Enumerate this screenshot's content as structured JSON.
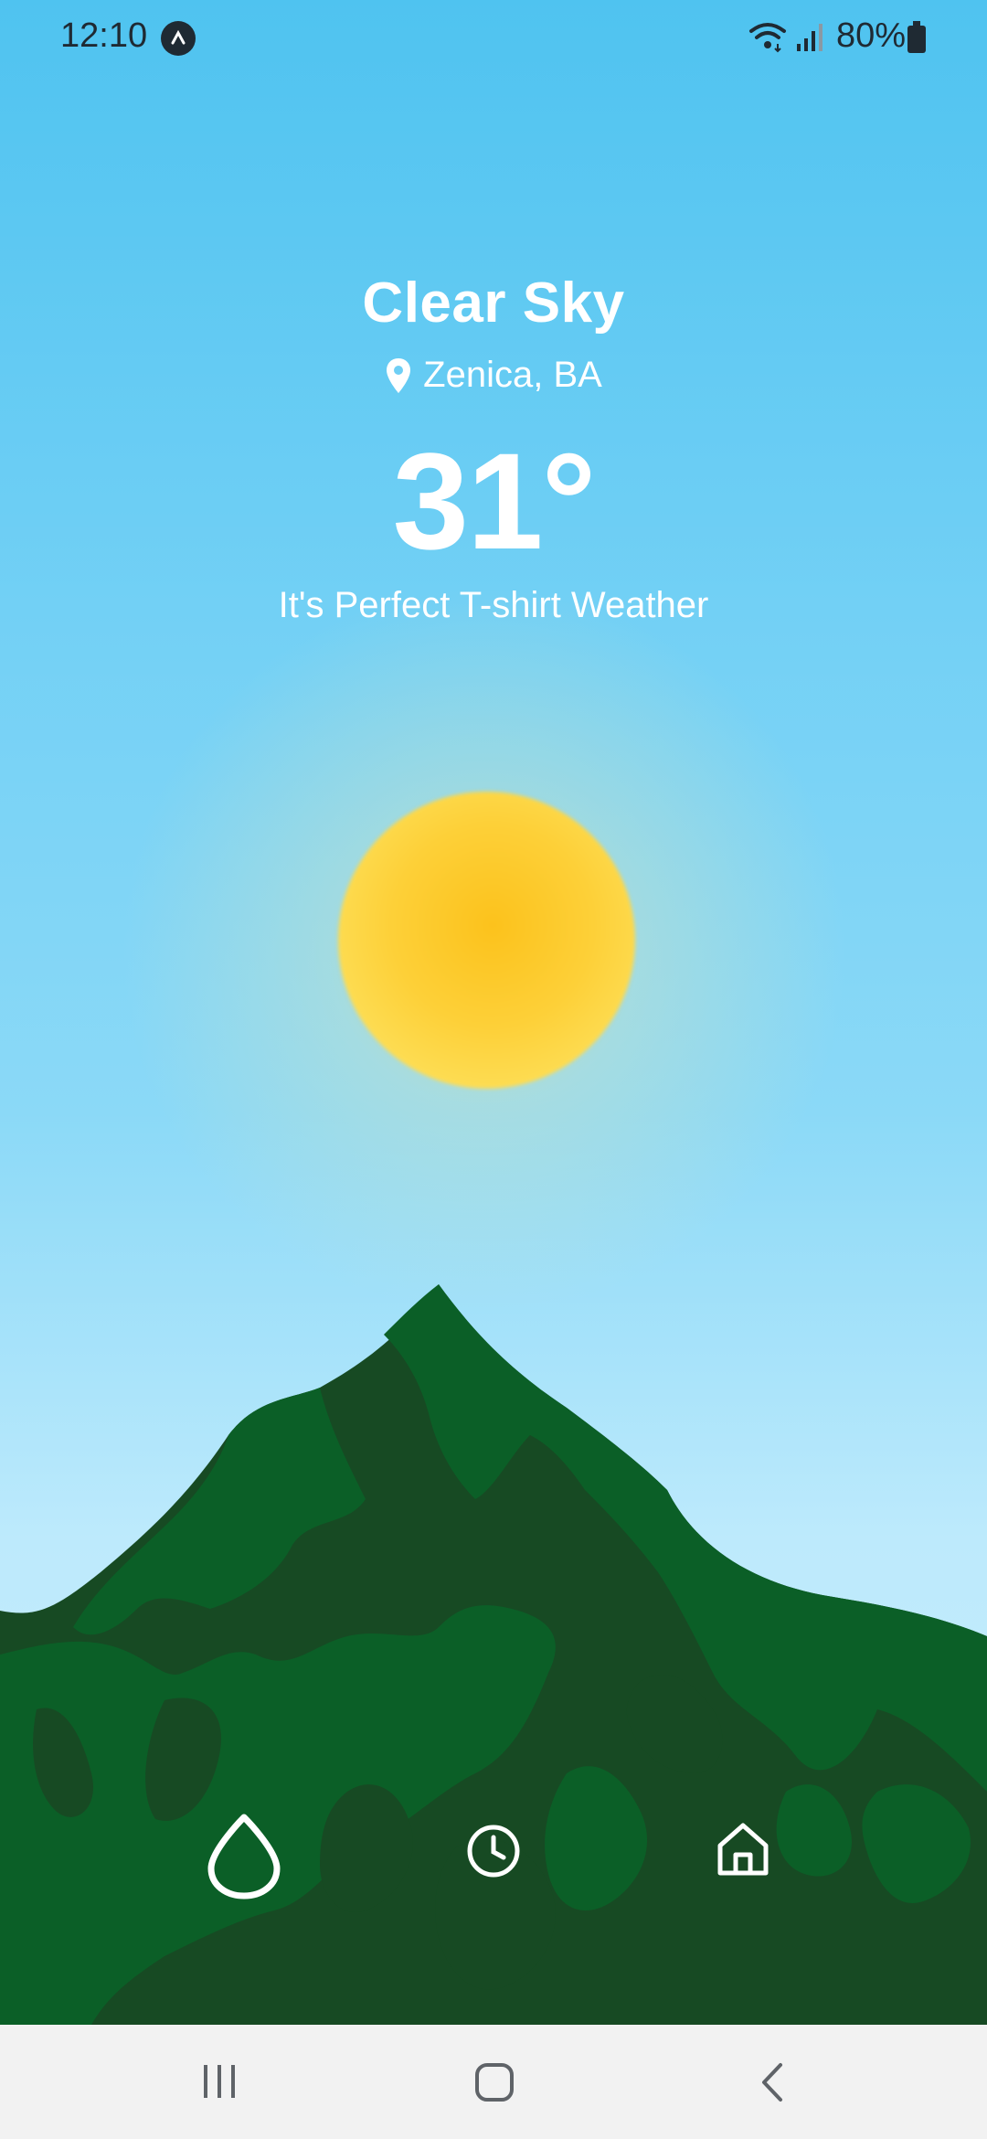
{
  "status_bar": {
    "time": "12:10",
    "battery_percent": "80%",
    "icons": [
      "app-badge-icon",
      "wifi-icon",
      "signal-icon",
      "battery-icon"
    ]
  },
  "weather": {
    "condition": "Clear Sky",
    "location": "Zenica, BA",
    "temperature": "31°",
    "message": "It's Perfect T-shirt Weather"
  },
  "tabs": [
    {
      "icon": "droplet-icon",
      "active": true
    },
    {
      "icon": "clock-icon",
      "active": false
    },
    {
      "icon": "home-icon",
      "active": false
    }
  ],
  "nav_bar": {
    "buttons": [
      "recent-apps-icon",
      "home-button-icon",
      "back-icon"
    ]
  },
  "colors": {
    "sky_top": "#4fc3f0",
    "sky_bottom": "#c9eefc",
    "sun": "#fdd038",
    "mountain_dark": "#174a23",
    "mountain_light": "#0b5f27",
    "text": "#ffffff"
  }
}
